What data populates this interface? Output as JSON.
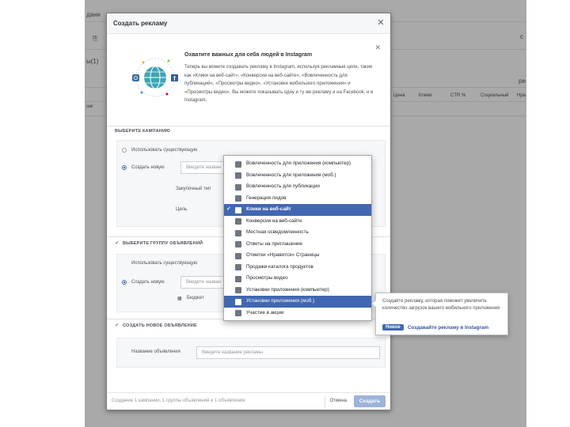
{
  "background_app": {
    "top_left_fragment": "данн",
    "toolbar_fragment": "ы(1)",
    "right_fragment": "с",
    "right_fragment_2": "ре",
    "table_headers": [
      "Цена",
      "Клики",
      "CTR %",
      "Социальный",
      "Нра"
    ],
    "row_fragment": "ше"
  },
  "dialog": {
    "title": "Создать рекламу",
    "promo": {
      "title": "Охватите важных для себя людей в Instagram",
      "body": "Теперь вы можете создавать рекламу в Instagram, используя рекламные цели, такие как «Клики на веб-сайт», «Конверсии на веб-сайте», «Вовлеченность для публикаций», «Просмотры видео», «Установки мобильного приложения» и «Просмотры видео». Вы можете показывать одну и ту же рекламу и на Facebook, и в Instagram."
    },
    "campaign_section": {
      "title": "ВЫБЕРИТЕ КАМПАНИЮ",
      "use_existing_label": "Использовать существующую",
      "create_new_label": "Создать новую",
      "name_placeholder": "Введите назван",
      "buying_type_label": "Закупочный тип",
      "objective_label": "Цель"
    },
    "adset_section": {
      "title": "ВЫБЕРИТЕ ГРУППУ ОБЪЯВЛЕНИЙ",
      "use_existing_label": "Использовать существующую",
      "create_new_label": "Создать новую",
      "name_placeholder": "Введите назван",
      "budget_label": "Бюджет"
    },
    "ad_section": {
      "title": "СОЗДАТЬ НОВОЕ ОБЪЯВЛЕНИЕ",
      "name_label": "Название объявления",
      "name_placeholder": "Введите название рекламы"
    },
    "footer": {
      "note": "Создание 1 кампании, 1 группы объявлений и 1 объявления",
      "cancel_label": "Отмена",
      "create_label": "Создать"
    }
  },
  "objective_dropdown": {
    "items": [
      {
        "label": "Вовлеченность для приложения (компьютер)",
        "state": "normal"
      },
      {
        "label": "Вовлеченность для приложения (моб.)",
        "state": "normal"
      },
      {
        "label": "Вовлеченность для публикации",
        "state": "normal"
      },
      {
        "label": "Генерация лидов",
        "state": "normal"
      },
      {
        "label": "Клики на веб-сайт",
        "state": "selected"
      },
      {
        "label": "Конверсии на веб-сайте",
        "state": "normal"
      },
      {
        "label": "Местная осведомленность",
        "state": "normal"
      },
      {
        "label": "Ответы на приглашение",
        "state": "normal"
      },
      {
        "label": "Отметки «Нравится» Страницы",
        "state": "normal"
      },
      {
        "label": "Продажи каталога продуктов",
        "state": "normal"
      },
      {
        "label": "Просмотры видео",
        "state": "normal"
      },
      {
        "label": "Установки приложения (компьютер)",
        "state": "normal"
      },
      {
        "label": "Установки приложения (моб.)",
        "state": "highlighted"
      },
      {
        "label": "Участие в акции",
        "state": "normal"
      }
    ]
  },
  "tooltip": {
    "text": "Создайте рекламу, которая поможет увеличить количество загрузок вашего мобильного приложения",
    "badge": "Новое",
    "link": "Создавайте рекламу в Instagram"
  },
  "colors": {
    "accent": "#4267b2",
    "overlay": "#8f8f8f",
    "create_button": "#9cb4d8"
  }
}
